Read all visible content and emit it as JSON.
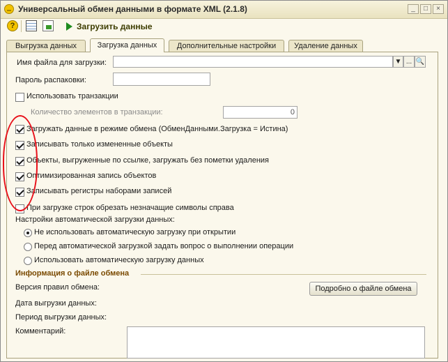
{
  "window": {
    "title": "Универсальный обмен данными в формате XML (2.1.8)",
    "controls": [
      "_",
      "□",
      "×"
    ]
  },
  "toolbar": {
    "help_glyph": "?",
    "load_label": "Загрузить данные"
  },
  "tabs": [
    {
      "label": "Выгрузка данных",
      "active": false
    },
    {
      "label": "Загрузка данных",
      "active": true
    },
    {
      "label": "Дополнительные настройки",
      "active": false
    },
    {
      "label": "Удаление данных",
      "active": false
    }
  ],
  "form": {
    "file_label": "Имя файла для загрузки:",
    "file_value": "",
    "dropdown_glyph": "▼",
    "ellipsis_glyph": "...",
    "search_glyph": "🔍",
    "password_label": "Пароль распаковки:",
    "password_value": "",
    "use_transactions": {
      "label": "Использовать транзакции",
      "checked": false
    },
    "tx_count_label": "Количество элементов в транзакции:",
    "tx_count_value": "0",
    "options": [
      {
        "label": "Загружать данные в режиме обмена (ОбменДанными.Загрузка = Истина)",
        "checked": true
      },
      {
        "label": "Записывать только измененные объекты",
        "checked": true
      },
      {
        "label": "Объекты, выгруженные по ссылке, загружать без пометки удаления",
        "checked": true
      },
      {
        "label": "Оптимизированная запись объектов",
        "checked": true
      },
      {
        "label": "Записывать регистры наборами записей",
        "checked": true
      },
      {
        "label": "При загрузке строк обрезать незначащие символы справа",
        "checked": false
      }
    ],
    "autoload_label": "Настройки автоматической загрузки данных:",
    "autoload_options": [
      {
        "label": "Не использовать автоматическую загрузку при открытии",
        "selected": true
      },
      {
        "label": "Перед автоматической загрузкой задать вопрос о выполнении операции",
        "selected": false
      },
      {
        "label": "Использовать автоматическую загрузку данных",
        "selected": false
      }
    ]
  },
  "info": {
    "section_title": "Информация о файле обмена",
    "rules_version_label": "Версия правил обмена:",
    "details_button": "Подробно о файле обмена",
    "export_date_label": "Дата выгрузки данных:",
    "export_period_label": "Период выгрузки данных:",
    "comment_label": "Комментарий:",
    "comment_value": ""
  },
  "annotation": {
    "color": "#e8101a"
  }
}
